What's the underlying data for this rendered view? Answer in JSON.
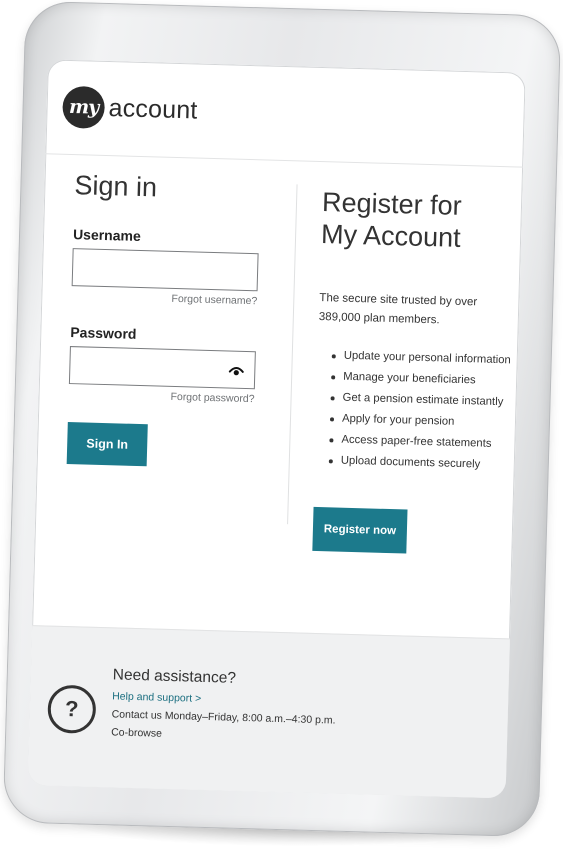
{
  "logo": {
    "badge": "my",
    "word": "account"
  },
  "signin": {
    "title": "Sign in",
    "username_label": "Username",
    "forgot_username": "Forgot username?",
    "password_label": "Password",
    "forgot_password": "Forgot password?",
    "button_label": "Sign In"
  },
  "register": {
    "title_line1": "Register for",
    "title_line2": "My Account",
    "intro_line1": "The secure site trusted by over",
    "intro_line2": "389,000 plan members.",
    "benefits": [
      "Update your personal information",
      "Manage your beneficiaries",
      "Get a pension estimate instantly",
      "Apply for your pension",
      "Access paper-free statements",
      "Upload documents securely"
    ],
    "button_label": "Register now"
  },
  "footer": {
    "help_glyph": "?",
    "title": "Need assistance?",
    "help_link": "Help and support >",
    "hours": "Contact us Monday–Friday, 8:00 a.m.–4:30 p.m.",
    "cobrowse": "Co-browse"
  },
  "colors": {
    "accent": "#1c7a8c",
    "text": "#333333",
    "footer_bg": "#f0f1f2"
  }
}
